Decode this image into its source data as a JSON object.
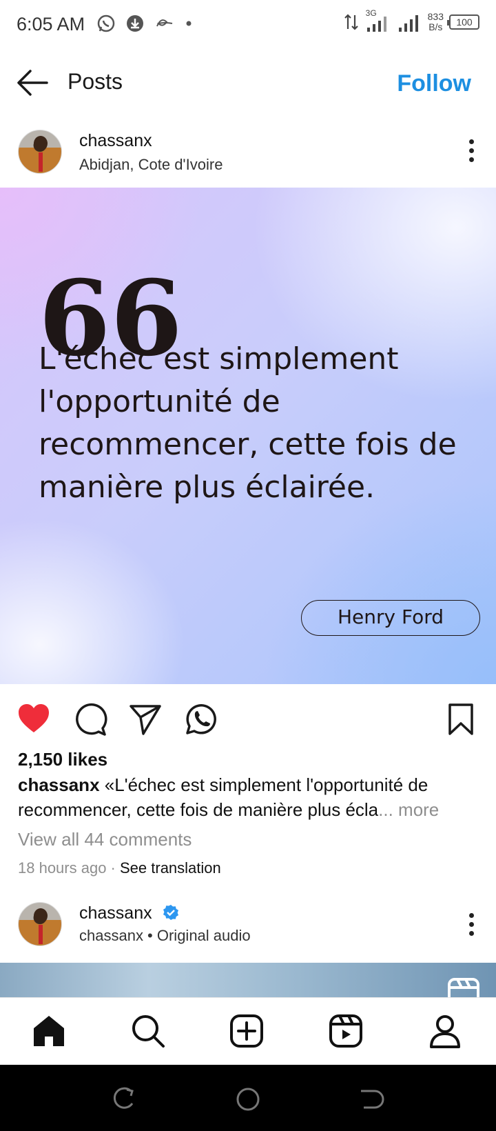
{
  "status_bar": {
    "time": "6:05 AM",
    "network_type": "3G",
    "speed_value": "833",
    "speed_unit": "B/s",
    "battery": "100"
  },
  "header": {
    "title": "Posts",
    "follow_label": "Follow"
  },
  "post": {
    "username": "chassanx",
    "location": "Abidjan, Cote d'Ivoire",
    "image": {
      "quote_mark": "66",
      "quote_text": "L'échec est simplement l'opportunité de recommencer, cette fois de manière plus éclairée.",
      "author": "Henry Ford"
    },
    "likes": "2,150 likes",
    "caption_user": "chassanx",
    "caption_text": "«L'échec est simplement l'opportunité de recommencer, cette fois de manière plus écla",
    "caption_more": "... more",
    "view_comments": "View all 44 comments",
    "time_ago": "18 hours ago",
    "separator": " · ",
    "see_translation": "See translation",
    "liked": true
  },
  "next_post": {
    "username": "chassanx",
    "subtitle": "chassanx • Original audio",
    "verified": true
  },
  "colors": {
    "follow": "#1d8fe1",
    "like": "#ef2d3a",
    "verified": "#2d97f0"
  }
}
